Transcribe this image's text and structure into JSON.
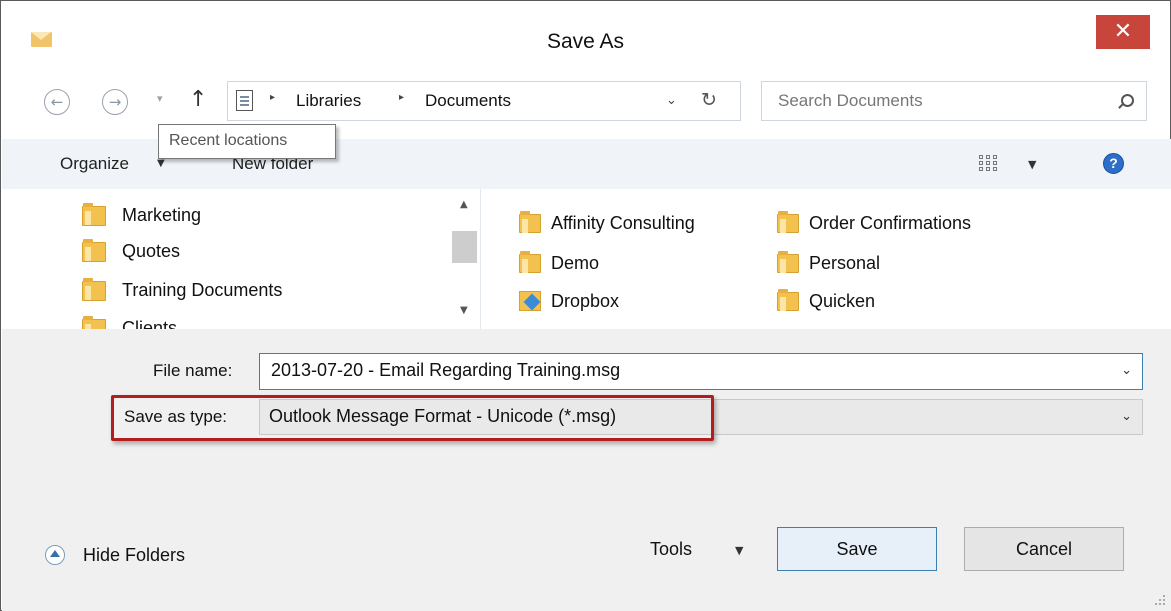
{
  "window": {
    "title": "Save As",
    "close_label": "✕"
  },
  "nav": {
    "back_icon": "←",
    "forward_icon": "→",
    "recent_caret": "▾",
    "up_icon": "↑",
    "breadcrumb": [
      "Libraries",
      "Documents"
    ],
    "breadcrumb_sep": "▸",
    "address_caret": "⌄",
    "refresh_icon": "↻",
    "search_placeholder": "Search Documents"
  },
  "tooltip": {
    "text": "Recent locations"
  },
  "toolbar": {
    "organize_label": "Organize",
    "organize_caret": "▼",
    "new_folder_label": "New folder",
    "view_caret": "▼",
    "help_label": "?"
  },
  "nav_pane": {
    "items": [
      {
        "label": "Marketing"
      },
      {
        "label": "Quotes"
      },
      {
        "label": "Training Documents"
      },
      {
        "label": "Clients"
      }
    ],
    "scroll_up": "▲",
    "scroll_down": "▼"
  },
  "file_pane": {
    "items": [
      {
        "label": "Affinity Consulting",
        "icon": "folder-icon"
      },
      {
        "label": "Demo",
        "icon": "folder-icon"
      },
      {
        "label": "Dropbox",
        "icon": "dropbox-folder-icon"
      },
      {
        "label": "Order Confirmations",
        "icon": "folder-icon"
      },
      {
        "label": "Personal",
        "icon": "folder-icon"
      },
      {
        "label": "Quicken",
        "icon": "folder-icon"
      }
    ]
  },
  "form": {
    "file_name_label": "File name:",
    "file_name_value": "2013-07-20 - Email Regarding Training.msg",
    "save_as_type_label": "Save as type:",
    "save_as_type_value": "Outlook Message Format - Unicode (*.msg)",
    "dropdown_caret": "⌄"
  },
  "footer": {
    "hide_folders_label": "Hide Folders",
    "tools_label": "Tools",
    "tools_caret": "▼",
    "save_label": "Save",
    "cancel_label": "Cancel"
  },
  "colors": {
    "close_button": "#c7453b",
    "highlight_box": "#b21d1d",
    "toolbar_bg": "#f0f4f9",
    "bottom_bg": "#f0f0f0",
    "focus_border": "#3c7fb1"
  }
}
